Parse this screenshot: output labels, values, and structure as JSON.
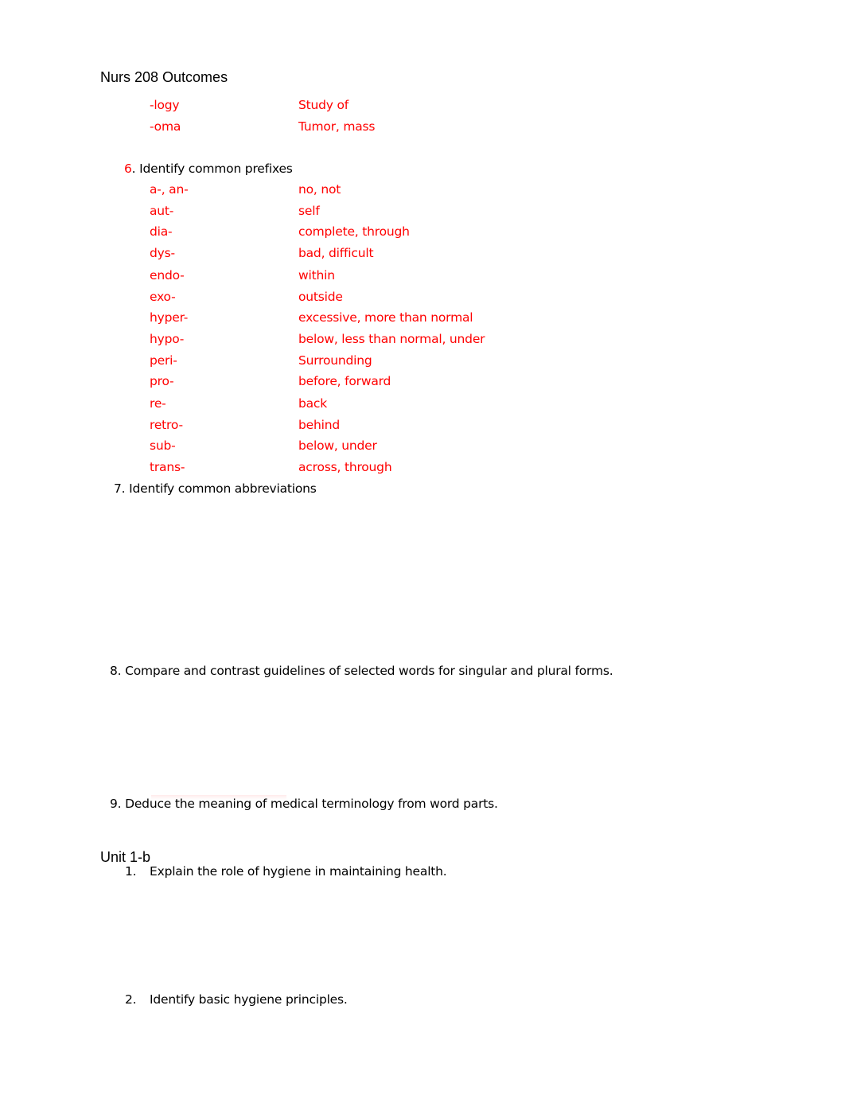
{
  "document": {
    "title": "Nurs 208 Outcomes",
    "suffix_rows": [
      {
        "term": "-logy",
        "meaning": "Study of"
      },
      {
        "term": "-oma",
        "meaning": "Tumor, mass"
      }
    ],
    "outcome6": {
      "number": "6",
      "text": ". Identify common prefixes",
      "prefix_rows": [
        {
          "term": "a-, an-",
          "meaning": "no, not"
        },
        {
          "term": "aut-",
          "meaning": "self"
        },
        {
          "term": "dia-",
          "meaning": "complete, through"
        },
        {
          "term": "dys-",
          "meaning": "bad, difficult"
        },
        {
          "term": "endo-",
          "meaning": "within"
        },
        {
          "term": "exo-",
          "meaning": "outside"
        },
        {
          "term": "hyper-",
          "meaning": "excessive, more than normal"
        },
        {
          "term": "hypo-",
          "meaning": "below, less than normal, under"
        },
        {
          "term": "peri-",
          "meaning": "Surrounding"
        },
        {
          "term": "pro-",
          "meaning": "before, forward"
        },
        {
          "term": "re-",
          "meaning": "back"
        },
        {
          "term": "retro-",
          "meaning": "behind"
        },
        {
          "term": "sub-",
          "meaning": "below, under"
        },
        {
          "term": "trans-",
          "meaning": "across, through"
        }
      ]
    },
    "outcome7": "7. Identify common abbreviations",
    "outcome8": "8. Compare and contrast guidelines of selected words for singular and plural forms.",
    "outcome9": "9. Deduce the meaning of medical terminology from word parts.",
    "unit_heading": "Unit 1-b",
    "unit_items": [
      {
        "number": "1.",
        "text": "Explain the role of hygiene in maintaining health."
      },
      {
        "number": "2.",
        "text": "Identify basic hygiene principles."
      }
    ]
  },
  "colors": {
    "term_color": "#ff0000",
    "text_color": "#000000"
  }
}
